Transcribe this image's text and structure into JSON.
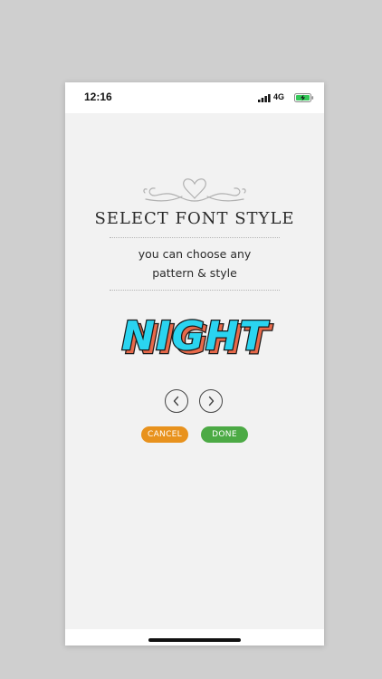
{
  "status_bar": {
    "time": "12:16",
    "network": "4G",
    "battery_color": "#34c759"
  },
  "dialog": {
    "title": "SELECT FONT STYLE",
    "subtitle_line1": "you can choose any",
    "subtitle_line2": "pattern & style",
    "preview_text": "NIGHT",
    "preview_fill_color": "#2ad4f0",
    "preview_shadow_color": "#e8694a",
    "cancel_label": "CANCEL",
    "done_label": "DONE",
    "cancel_color": "#e8921d",
    "done_color": "#4caa45"
  }
}
